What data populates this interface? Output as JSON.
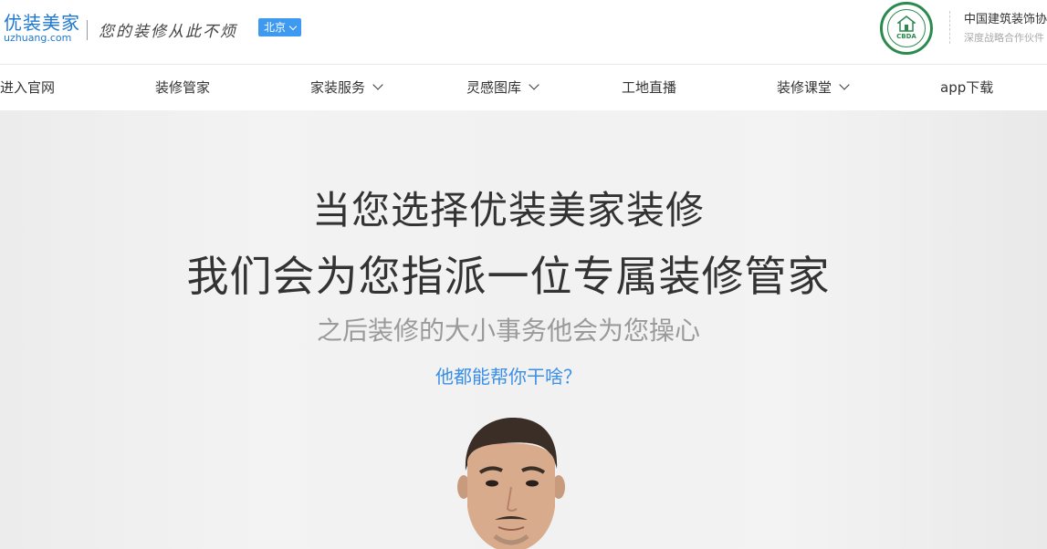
{
  "header": {
    "logo_cn": "优装美家",
    "logo_en": "uzhuang.com",
    "slogan": "您的装修从此不烦",
    "city": "北京",
    "partner_name": "中国建筑装饰协",
    "partner_sub": "深度战略合作伙件",
    "seal_text": "CBDA",
    "brand_color": "#1e78d2",
    "seal_color": "#2b8a4e"
  },
  "nav": {
    "items": [
      {
        "label": "进入官网",
        "dropdown": false
      },
      {
        "label": "装修管家",
        "dropdown": false
      },
      {
        "label": "家装服务",
        "dropdown": true
      },
      {
        "label": "灵感图库",
        "dropdown": true
      },
      {
        "label": "工地直播",
        "dropdown": false
      },
      {
        "label": "装修课堂",
        "dropdown": true
      },
      {
        "label": "app下载",
        "dropdown": false
      }
    ]
  },
  "hero": {
    "line1": "当您选择优装美家装修",
    "line2": "我们会为您指派一位专属装修管家",
    "line3": "之后装修的大小事务他会为您操心",
    "line4": "他都能帮你干啥？",
    "link_color": "#3b8fe6"
  }
}
